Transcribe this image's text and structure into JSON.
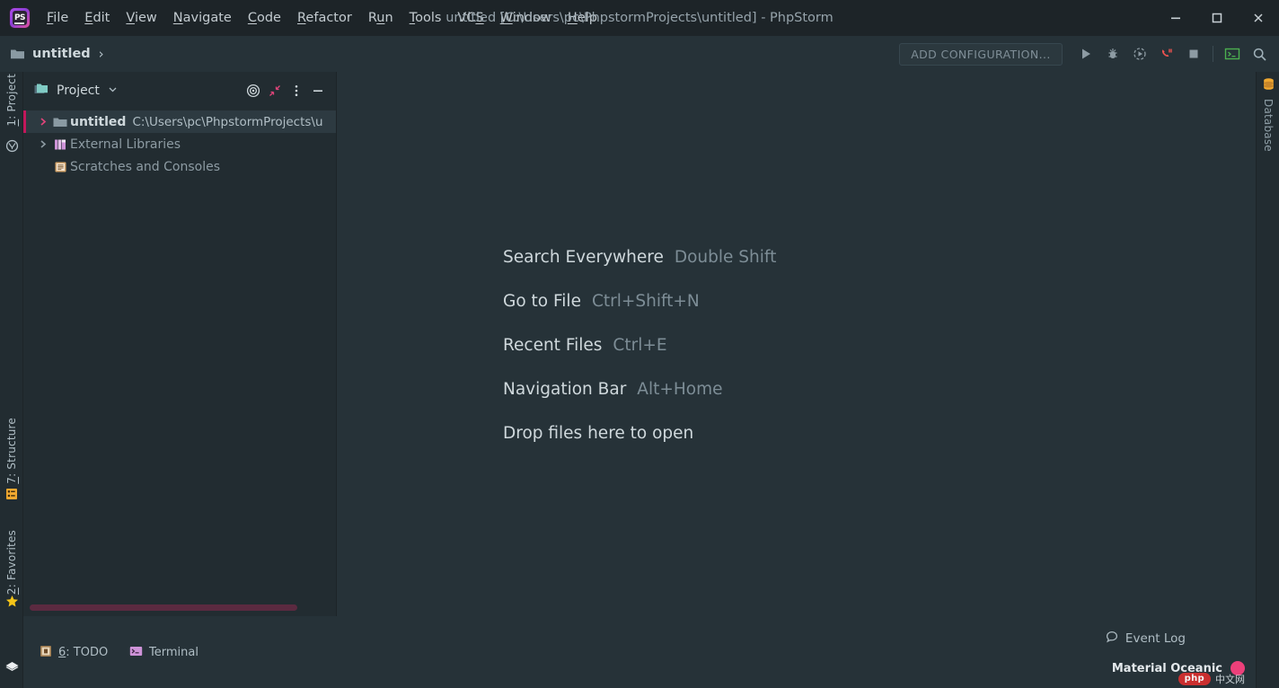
{
  "window": {
    "title": "untitled [C:\\Users\\pc\\PhpstormProjects\\untitled] - PhpStorm",
    "logo_text": "PS",
    "minimize_icon": "minimize-icon",
    "maximize_icon": "maximize-icon",
    "close_icon": "close-icon"
  },
  "menubar": {
    "items": [
      {
        "label": "File",
        "mnemonic": "F",
        "rest": "ile"
      },
      {
        "label": "Edit",
        "mnemonic": "E",
        "rest": "dit"
      },
      {
        "label": "View",
        "mnemonic": "V",
        "rest": "iew"
      },
      {
        "label": "Navigate",
        "mnemonic": "N",
        "rest": "avigate"
      },
      {
        "label": "Code",
        "mnemonic": "C",
        "rest": "ode"
      },
      {
        "label": "Refactor",
        "mnemonic": "R",
        "rest": "efactor"
      },
      {
        "label": "Run",
        "mnemonic": "u",
        "pre": "R",
        "rest": "n"
      },
      {
        "label": "Tools",
        "mnemonic": "T",
        "rest": "ools"
      },
      {
        "label": "VCS",
        "mnemonic": "S",
        "pre": "VC",
        "rest": ""
      },
      {
        "label": "Window",
        "mnemonic": "W",
        "rest": "indow"
      },
      {
        "label": "Help",
        "mnemonic": "H",
        "rest": "elp"
      }
    ]
  },
  "navbar": {
    "breadcrumb": "untitled",
    "chevron": "›",
    "folder_icon": "folder-icon"
  },
  "toolbar": {
    "add_configuration": "ADD CONFIGURATION...",
    "run_icon": "run-icon",
    "debug_icon": "debug-icon",
    "profile_icon": "run-with-coverage-icon",
    "attach_icon": "attach-debugger-icon",
    "stop_icon": "stop-icon",
    "terminal_icon": "terminal-icon",
    "search_icon": "search-icon"
  },
  "left_strip": {
    "project_button": {
      "number": "1",
      "label": ": Project",
      "icon": "project-icon"
    },
    "structure_button": {
      "number": "7",
      "label": ": Structure",
      "icon": "structure-icon"
    },
    "favorites_button": {
      "number": "2",
      "label": ": Favorites",
      "icon": "star-icon"
    },
    "layers_icon": "layers-icon"
  },
  "right_strip": {
    "database_button": {
      "label": "Database",
      "icon": "database-icon"
    }
  },
  "project_panel": {
    "title": "Project",
    "chevron": "⌄",
    "folder_icon": "project-folder-icon",
    "locate_icon": "select-opened-file-icon",
    "collapse_icon": "collapse-all-icon",
    "options_icon": "options-menu-icon",
    "hide_icon": "hide-panel-icon",
    "tree": [
      {
        "name": "untitled",
        "path": "C:\\Users\\pc\\PhpstormProjects\\u",
        "icon": "folder-icon",
        "arrow": "›",
        "selected": true,
        "bold": true
      },
      {
        "name": "External Libraries",
        "path": "",
        "icon": "library-icon",
        "arrow": "›",
        "selected": false,
        "bold": false
      },
      {
        "name": "Scratches and Consoles",
        "path": "",
        "icon": "scratches-icon",
        "arrow": "",
        "selected": false,
        "bold": false
      }
    ]
  },
  "editor_hints": [
    {
      "label": "Search Everywhere",
      "key": "Double Shift"
    },
    {
      "label": "Go to File",
      "key": "Ctrl+Shift+N"
    },
    {
      "label": "Recent Files",
      "key": "Ctrl+E"
    },
    {
      "label": "Navigation Bar",
      "key": "Alt+Home"
    },
    {
      "label": "Drop files here to open",
      "key": ""
    }
  ],
  "status_bar": {
    "todo_button": {
      "number": "6",
      "label": ": TODO",
      "icon": "todo-icon"
    },
    "terminal_button": {
      "label": "Terminal",
      "icon": "terminal-icon"
    },
    "event_log": {
      "label": "Event Log",
      "icon": "event-log-icon"
    },
    "theme": {
      "name": "Material Oceanic",
      "dot_color": "#ec407a"
    },
    "watermark": {
      "badge": "php",
      "text": "中文网"
    }
  },
  "colors": {
    "titlebar_bg": "#1d2428",
    "editor_bg": "#263238",
    "panel_bg": "#222c31",
    "accent_pink": "#c2185b",
    "selection_bg": "#2d3a41",
    "text_primary": "#cfd8dc",
    "text_muted": "#7d8d96"
  }
}
